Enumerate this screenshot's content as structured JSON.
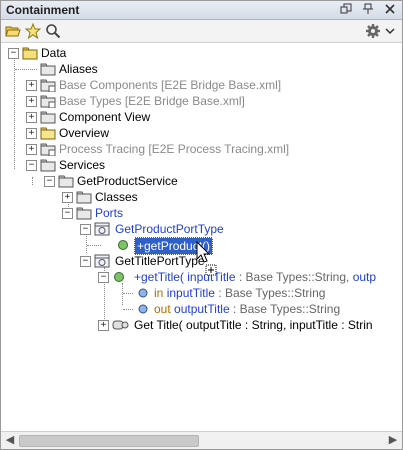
{
  "panel": {
    "title": "Containment"
  },
  "titlebar_icons": [
    "restore-icon",
    "pin-icon",
    "close-icon"
  ],
  "toolbar": {
    "left_icons": [
      "open-folder-icon",
      "star-icon",
      "search-icon"
    ],
    "right_icon": "gear-icon"
  },
  "tree": {
    "data": "Data",
    "aliases": "Aliases",
    "base_components": "Base Components [E2E Bridge Base.xml]",
    "base_types": "Base Types [E2E Bridge Base.xml]",
    "component_view": "Component View",
    "overview": "Overview",
    "process_tracing": "Process Tracing [E2E Process Tracing.xml]",
    "services": "Services",
    "get_product_service": "GetProductService",
    "classes": "Classes",
    "ports": "Ports",
    "get_product_port_type": "GetProductPortType",
    "get_product_op": "+getProduct()",
    "get_title_port_type": "GetTitlePortType",
    "get_title_op": {
      "name": "+getTitle(",
      "in_word": "inputTitle",
      "type": " : Base Types::String,",
      "out_word": " outp"
    },
    "param_in": {
      "dir": "in",
      "name": "inputTitle",
      "type": " : Base Types::String"
    },
    "param_out": {
      "dir": "out",
      "name": "outputTitle",
      "type": " : Base Types::String"
    },
    "get_title_impl": "Get Title( outputTitle : String, inputTitle : Strin"
  },
  "colors": {
    "accent_blue": "#1f3fd0",
    "selection": "#2f60c8",
    "grey_text": "#8a8a8a",
    "folder_yellow": "#f3d65a"
  }
}
